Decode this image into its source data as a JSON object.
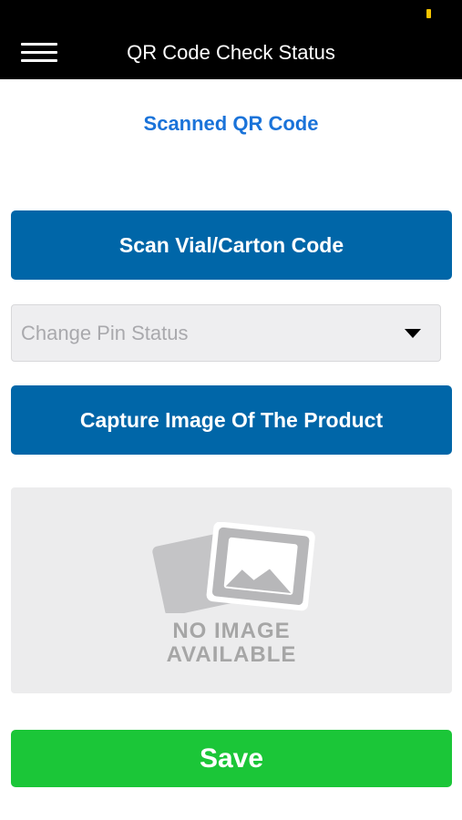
{
  "header": {
    "title": "QR Code Check Status",
    "menu_icon": "hamburger-menu-icon"
  },
  "scanned_link": "Scanned QR Code",
  "scan_button": "Scan Vial/Carton Code",
  "pin_status_select": {
    "placeholder": "Change Pin Status",
    "icon": "triangle-down-icon"
  },
  "capture_button": "Capture Image Of The Product",
  "image_placeholder": {
    "line1": "NO IMAGE",
    "line2": "AVAILABLE",
    "icon": "no-image-photo-icon"
  },
  "save_button": "Save",
  "colors": {
    "header_bg": "#000000",
    "link": "#1a73d9",
    "primary": "#0066a8",
    "save": "#1bc638",
    "status_indicator": "#f5c400"
  }
}
